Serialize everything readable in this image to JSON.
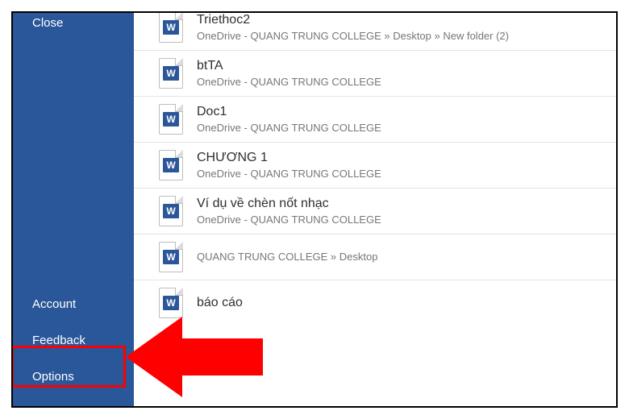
{
  "sidebar": {
    "top": [
      {
        "label": "Close",
        "name": "sidebar-item-close"
      }
    ],
    "bottom": [
      {
        "label": "Account",
        "name": "sidebar-item-account"
      },
      {
        "label": "Feedback",
        "name": "sidebar-item-feedback"
      },
      {
        "label": "Options",
        "name": "sidebar-item-options"
      }
    ]
  },
  "files": [
    {
      "name": "Triethoc2",
      "path": "OneDrive - QUANG TRUNG COLLEGE » Desktop » New folder (2)"
    },
    {
      "name": "btTA",
      "path": "OneDrive - QUANG TRUNG COLLEGE"
    },
    {
      "name": "Doc1",
      "path": "OneDrive - QUANG TRUNG COLLEGE"
    },
    {
      "name": "CHƯƠNG 1",
      "path": "OneDrive - QUANG TRUNG COLLEGE"
    },
    {
      "name": "Ví dụ về chèn nốt nhạc",
      "path": "OneDrive - QUANG TRUNG COLLEGE"
    },
    {
      "name": "",
      "path": "QUANG TRUNG COLLEGE » Desktop"
    },
    {
      "name": "báo cáo",
      "path": ""
    }
  ],
  "icon_letter": "W",
  "annotation": {
    "highlight_target": "Options",
    "arrow_color": "#ff0000"
  }
}
